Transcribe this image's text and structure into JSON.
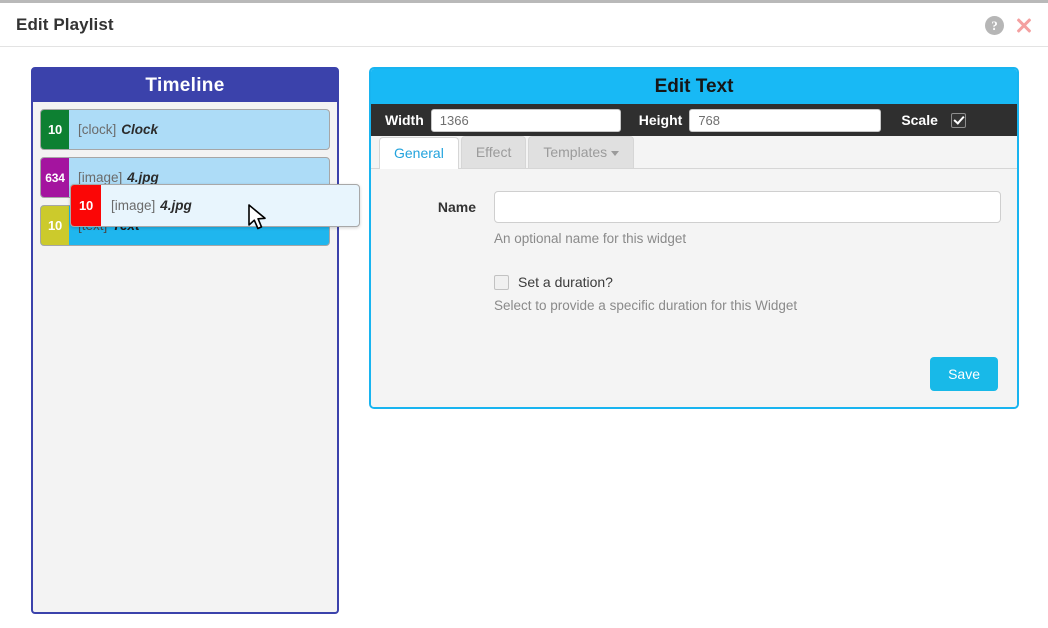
{
  "window": {
    "title": "Edit Playlist",
    "help_icon": "question-circle-icon",
    "close_icon": "close-icon"
  },
  "timeline": {
    "header": "Timeline",
    "items": [
      {
        "duration": "10",
        "type": "[clock]",
        "name": "Clock",
        "badge_color": "#0d8032"
      },
      {
        "duration": "634",
        "type": "[image]",
        "name": "4.jpg",
        "badge_color": "#a4149f"
      },
      {
        "duration": "10",
        "type": "[text]",
        "name": "Text",
        "badge_color": "#ccca2c"
      }
    ],
    "drag_clone": {
      "duration": "10",
      "type": "[image]",
      "name": "4.jpg",
      "badge_color": "#fb0606"
    }
  },
  "edit_panel": {
    "header": "Edit Text",
    "dimensions": {
      "width_label": "Width",
      "width_value": "1366",
      "height_label": "Height",
      "height_value": "768",
      "scale_label": "Scale",
      "scale_checked": true
    },
    "tabs": [
      {
        "label": "General",
        "active": true
      },
      {
        "label": "Effect",
        "active": false
      },
      {
        "label": "Templates",
        "active": false,
        "has_caret": true
      }
    ],
    "form": {
      "name_label": "Name",
      "name_value": "",
      "name_placeholder": "",
      "name_help": "An optional name for this widget",
      "duration_checkbox_label": "Set a duration?",
      "duration_checked": false,
      "duration_help": "Select to provide a specific duration for this Widget"
    },
    "save_label": "Save"
  },
  "colors": {
    "timeline_accent": "#3b42ab",
    "panel_accent": "#18b4f0",
    "save_button": "#18b9e8",
    "selected_item": "#1fb6ee",
    "normal_item": "#addcf7"
  }
}
